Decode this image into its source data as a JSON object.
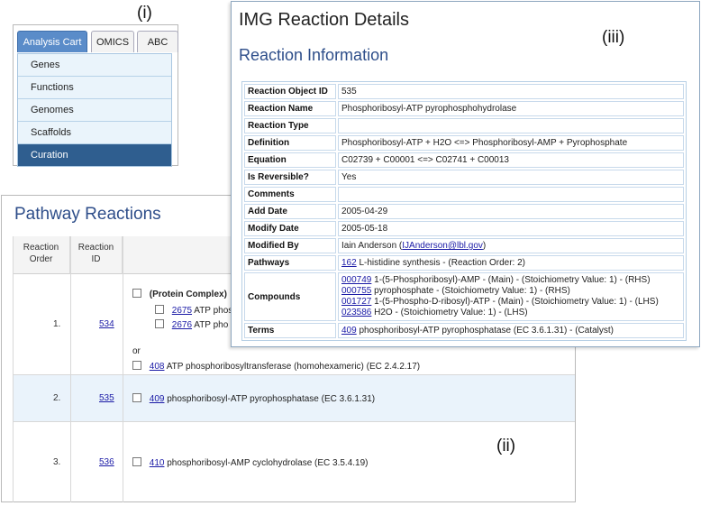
{
  "labels": {
    "i": "(i)",
    "ii": "(ii)",
    "iii": "(iii)"
  },
  "panel_i": {
    "tabs": [
      {
        "label": "Analysis Cart",
        "active": true
      },
      {
        "label": "OMICS",
        "active": false
      },
      {
        "label": "ABC",
        "active": false
      }
    ],
    "menu": [
      "Genes",
      "Functions",
      "Genomes",
      "Scaffolds",
      "Curation"
    ],
    "selected_menu": "Curation"
  },
  "panel_ii": {
    "title": "Pathway Reactions",
    "headers": {
      "order": "Reaction\nOrder",
      "id": "Reaction\nID"
    },
    "rows": [
      {
        "order": "1.",
        "id": "534",
        "complex_label": "(Protein Complex)",
        "complex_items": [
          {
            "id": "2675",
            "text": "ATP phos"
          },
          {
            "id": "2676",
            "text": "ATP pho"
          }
        ],
        "or_label": "or",
        "alt": {
          "id": "408",
          "text": "ATP phosphoribosyltransferase (homohexameric) (EC 2.4.2.17)"
        }
      },
      {
        "order": "2.",
        "id": "535",
        "item": {
          "id": "409",
          "text": "phosphoribosyl-ATP pyrophosphatase (EC 3.6.1.31)"
        }
      },
      {
        "order": "3.",
        "id": "536",
        "item": {
          "id": "410",
          "text": "phosphoribosyl-AMP cyclohydrolase (EC 3.5.4.19)"
        }
      }
    ]
  },
  "panel_iii": {
    "page_title": "IMG Reaction Details",
    "section_title": "Reaction Information",
    "fields": {
      "object_id": {
        "key": "Reaction Object ID",
        "value": "535"
      },
      "name": {
        "key": "Reaction Name",
        "value": "Phosphoribosyl-ATP pyrophosphohydrolase"
      },
      "type": {
        "key": "Reaction Type",
        "value": ""
      },
      "definition": {
        "key": "Definition",
        "value": "Phosphoribosyl-ATP + H2O <=> Phosphoribosyl-AMP + Pyrophosphate"
      },
      "equation": {
        "key": "Equation",
        "value": "C02739 + C00001 <=> C02741 + C00013"
      },
      "reversible": {
        "key": "Is Reversible?",
        "value": "Yes"
      },
      "comments": {
        "key": "Comments",
        "value": ""
      },
      "add_date": {
        "key": "Add Date",
        "value": "2005-04-29"
      },
      "modify_date": {
        "key": "Modify Date",
        "value": "2005-05-18"
      },
      "modified_by": {
        "key": "Modified By",
        "name": "Iain Anderson (",
        "email": "IJAnderson@lbl.gov",
        "close": ")"
      },
      "pathways": {
        "key": "Pathways",
        "link": "162",
        "text": " L-histidine synthesis - (Reaction Order: 2)"
      },
      "compounds": {
        "key": "Compounds",
        "items": [
          {
            "link": "000749",
            "text": " 1-(5-Phosphoribosyl)-AMP - (Main) - (Stoichiometry Value: 1) - (RHS)"
          },
          {
            "link": "000755",
            "text": " pyrophosphate - (Stoichiometry Value: 1) - (RHS)"
          },
          {
            "link": "001727",
            "text": " 1-(5-Phospho-D-ribosyl)-ATP - (Main) - (Stoichiometry Value: 1) - (LHS)"
          },
          {
            "link": "023586",
            "text": " H2O - (Stoichiometry Value: 1) - (LHS)"
          }
        ]
      },
      "terms": {
        "key": "Terms",
        "link": "409",
        "text": " phosphoribosyl-ATP pyrophosphatase (EC 3.6.1.31) - (Catalyst)"
      }
    }
  }
}
